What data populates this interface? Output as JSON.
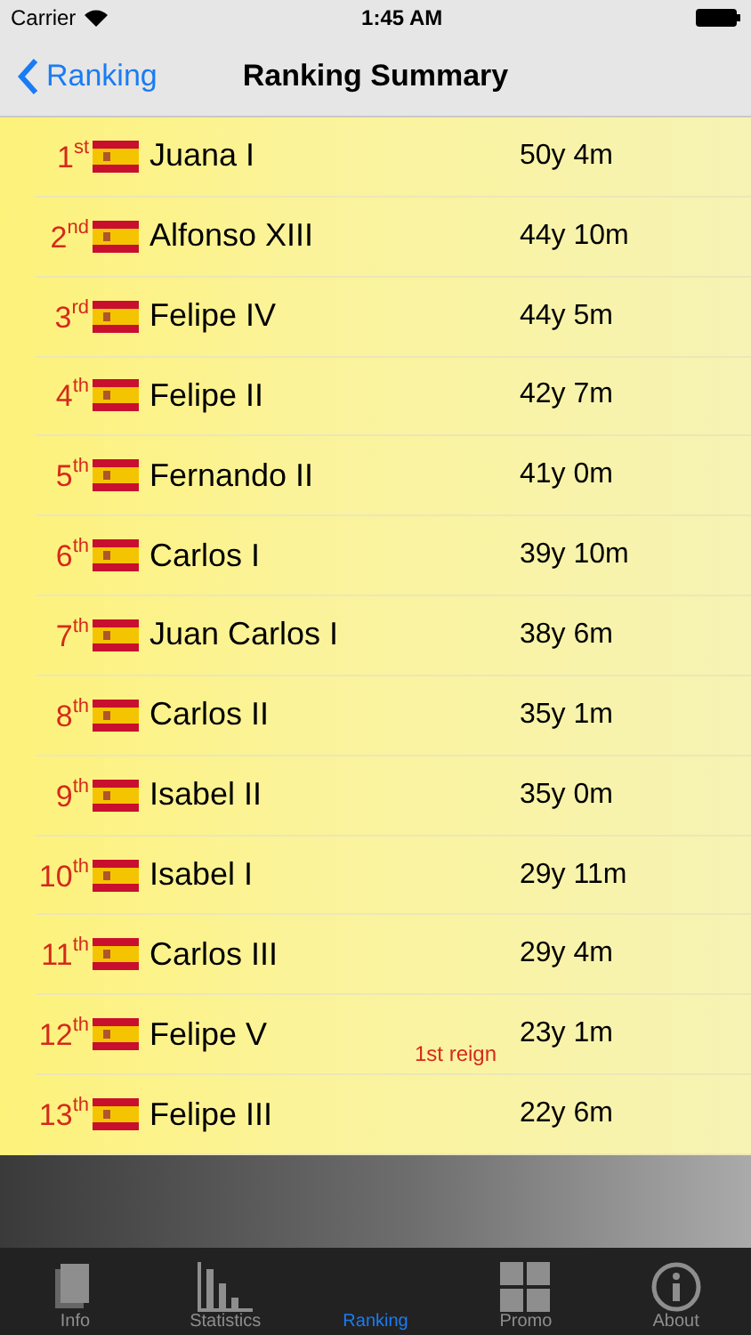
{
  "status_bar": {
    "carrier": "Carrier",
    "time": "1:45 AM"
  },
  "nav": {
    "back": "Ranking",
    "title": "Ranking Summary"
  },
  "rows": [
    {
      "rank": "1$^{st}$",
      "name": "Juana I",
      "duration": "50y 4m"
    },
    {
      "rank": "2$^{nd}$",
      "name": "Alfonso XIII",
      "duration": "44y 10m"
    },
    {
      "rank": "3$^{rd}$",
      "name": "Felipe IV",
      "duration": "44y 5m"
    },
    {
      "rank": "4$^{th}$",
      "name": "Felipe II",
      "duration": "42y 7m"
    },
    {
      "rank": "5$^{th}$",
      "name": "Fernando II",
      "duration": "41y 0m"
    },
    {
      "rank": "6$^{th}$",
      "name": "Carlos I",
      "duration": "39y 10m"
    },
    {
      "rank": "7$^{th}$",
      "name": "Juan Carlos I",
      "duration": "38y 6m"
    },
    {
      "rank": "8$^{th}$",
      "name": "Carlos II",
      "duration": "35y 1m"
    },
    {
      "rank": "9$^{th}$",
      "name": "Isabel II",
      "duration": "35y 0m"
    },
    {
      "rank": "10$^{th}$",
      "name": "Isabel I",
      "duration": "29y 11m"
    },
    {
      "rank": "11$^{th}$",
      "name": "Carlos III",
      "duration": "29y 4m"
    },
    {
      "rank": "12$^{th}$",
      "name": "Felipe V",
      "duration": "23y 1m",
      "note": "1st reign"
    },
    {
      "rank": "13$^{th}$",
      "name": "Felipe III",
      "duration": "22y 6m"
    }
  ],
  "tabs": [
    {
      "kind": "book",
      "label": "Info",
      "selected": false
    },
    {
      "kind": "stats",
      "label": "Statistics",
      "selected": false
    },
    {
      "kind": "none",
      "label": "Ranking",
      "selected": true
    },
    {
      "kind": "grid",
      "label": "Promo",
      "selected": false
    },
    {
      "kind": "info",
      "label": "About",
      "selected": false
    }
  ]
}
